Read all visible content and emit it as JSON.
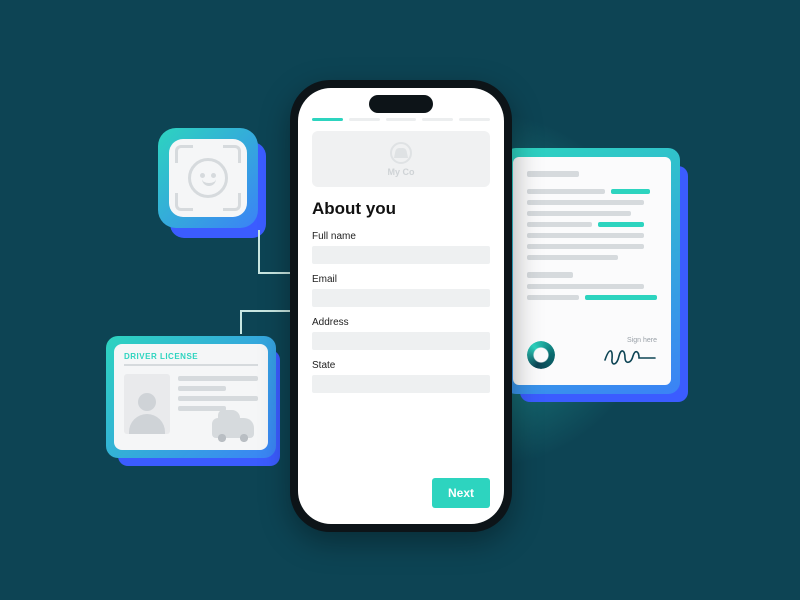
{
  "colors": {
    "bg": "#0d4454",
    "teal": "#2dd4bf",
    "blue": "#3b5cff"
  },
  "face_card": {
    "icon": "face-scan-icon"
  },
  "driver_license": {
    "title": "DRIVER LICENSE"
  },
  "document": {
    "sign_label": "Sign here",
    "stamp": "ring-stamp-icon"
  },
  "phone": {
    "brand": {
      "name": "My Co",
      "logo": "myco-logo-icon"
    },
    "heading": "About you",
    "fields": [
      {
        "label": "Full name"
      },
      {
        "label": "Email"
      },
      {
        "label": "Address"
      },
      {
        "label": "State"
      }
    ],
    "next_label": "Next",
    "progress_steps": 5,
    "progress_active": 1
  }
}
